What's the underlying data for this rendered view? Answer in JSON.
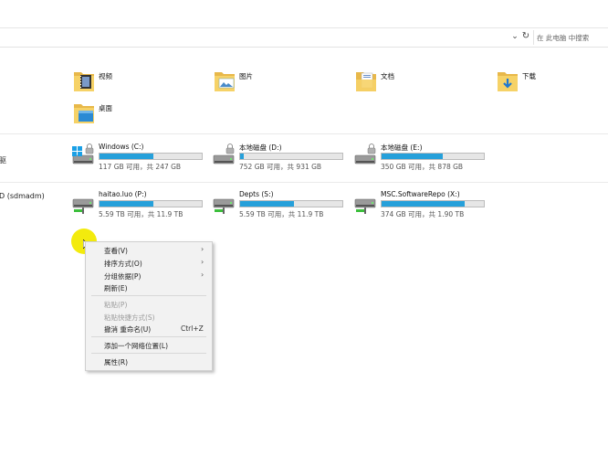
{
  "search": {
    "placeholder": "在 此电脑 中搜索"
  },
  "sidebar": {
    "label_one": "驱",
    "label_two": "D (sdmadm)"
  },
  "folders": [
    {
      "name": "视频",
      "icon": "video-folder-icon"
    },
    {
      "name": "图片",
      "icon": "pictures-folder-icon"
    },
    {
      "name": "文档",
      "icon": "documents-folder-icon"
    },
    {
      "name": "下载",
      "icon": "downloads-folder-icon"
    },
    {
      "name": "桌面",
      "icon": "desktop-folder-icon"
    }
  ],
  "drives": [
    {
      "name": "Windows (C:)",
      "info": "117 GB 可用，共 247 GB",
      "used_fraction": 0.53,
      "icon": "windows-drive-icon"
    },
    {
      "name": "本地磁盘 (D:)",
      "info": "752 GB 可用，共 931 GB",
      "used_fraction": 0.04,
      "icon": "local-disk-icon"
    },
    {
      "name": "本地磁盘 (E:)",
      "info": "350 GB 可用，共 878 GB",
      "used_fraction": 0.6,
      "icon": "local-disk-icon"
    }
  ],
  "network_drives": [
    {
      "name": "haitao.luo (P:)",
      "info": "5.59 TB 可用，共 11.9 TB",
      "used_fraction": 0.53,
      "icon": "network-drive-icon"
    },
    {
      "name": "Depts (S:)",
      "info": "5.59 TB 可用，共 11.9 TB",
      "used_fraction": 0.53,
      "icon": "network-drive-icon"
    },
    {
      "name": "MSC.SoftwareRepo (X:)",
      "info": "374 GB 可用，共 1.90 TB",
      "used_fraction": 0.81,
      "icon": "network-drive-icon"
    }
  ],
  "context_menu": {
    "items": [
      {
        "label": "查看(V)",
        "submenu": true
      },
      {
        "label": "排序方式(O)",
        "submenu": true
      },
      {
        "label": "分组依据(P)",
        "submenu": true
      },
      {
        "label": "刷新(E)"
      },
      {
        "label": "粘贴(P)",
        "disabled": true
      },
      {
        "label": "粘贴快捷方式(S)",
        "disabled": true
      },
      {
        "label": "撤消 重命名(U)",
        "shortcut": "Ctrl+Z"
      },
      {
        "label": "添加一个网络位置(L)"
      },
      {
        "label": "属性(R)"
      }
    ]
  },
  "colors": {
    "accent": "#26a0da",
    "highlight": "#f2ea00"
  }
}
